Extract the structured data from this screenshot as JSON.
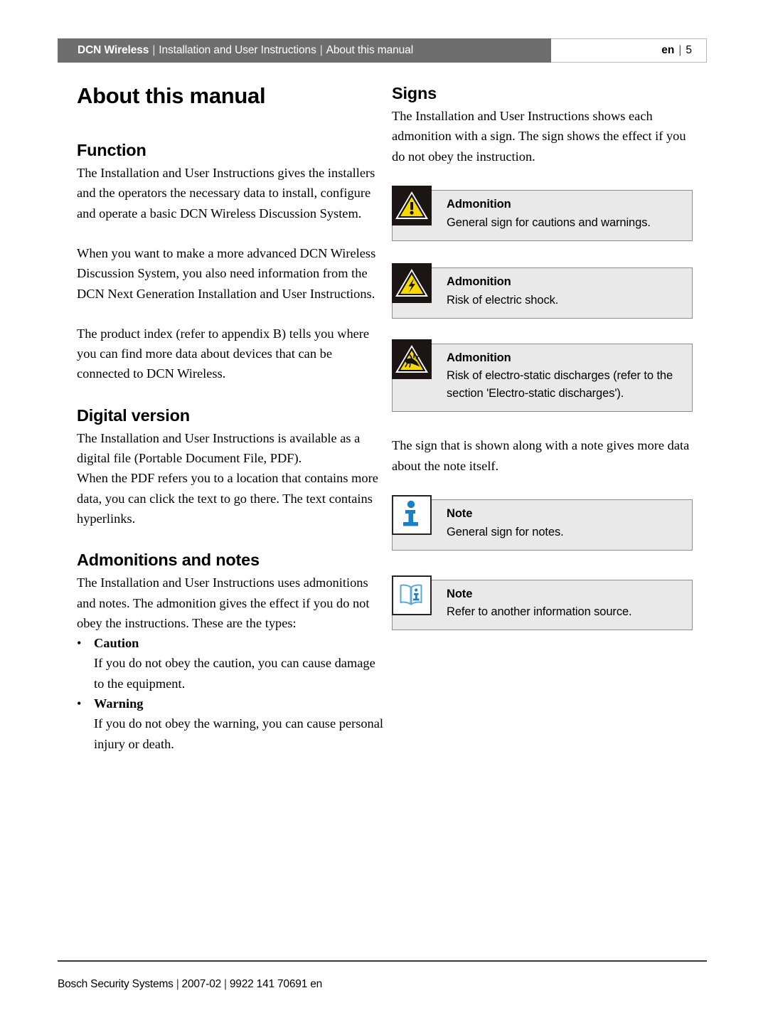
{
  "header": {
    "product": "DCN Wireless",
    "separator": "|",
    "doc_title": "Installation and User Instructions",
    "section": "About this manual",
    "language": "en",
    "page_number": "5"
  },
  "page_title": "About this manual",
  "left_column": {
    "function": {
      "heading": "Function",
      "paragraphs": [
        "The Installation and User Instructions gives the installers and the operators the necessary data to install, configure and operate a basic DCN Wireless Discussion System.",
        "When you want to make a more advanced DCN Wireless Discussion System, you also need information from the DCN Next Generation Installation and User Instructions.",
        "The product index (refer to appendix B) tells you where you can find more data about devices that can be connected to DCN Wireless."
      ]
    },
    "digital_version": {
      "heading": "Digital version",
      "paragraphs": [
        "The Installation and User Instructions is available as a digital file (Portable Document File, PDF).",
        "When the PDF refers you to a location that contains more data, you can click the text to go there. The text contains hyperlinks."
      ]
    },
    "admonitions_and_notes": {
      "heading": "Admonitions and notes",
      "intro": "The Installation and User Instructions uses admonitions and notes. The admonition gives the effect if you do not obey the instructions. These are the types:",
      "bullet": "•",
      "types": [
        {
          "term": "Caution",
          "description": "If you do not obey the caution, you can cause damage to the equipment."
        },
        {
          "term": "Warning",
          "description": "If you do not obey the warning, you can cause personal injury or death."
        }
      ]
    }
  },
  "right_column": {
    "signs": {
      "heading": "Signs",
      "intro": "The Installation and User Instructions shows each admonition with a sign. The sign shows the effect if you do not obey the instruction.",
      "note_intro": "The sign that is shown along with a note gives more data about the note itself."
    },
    "boxes": [
      {
        "icon": "warning-triangle-icon",
        "title": "Admonition",
        "text": "General sign for cautions and warnings."
      },
      {
        "icon": "electric-shock-icon",
        "title": "Admonition",
        "text": "Risk of electric shock."
      },
      {
        "icon": "esd-hand-icon",
        "title": "Admonition",
        "text": "Risk of electro-static discharges (refer to the section 'Electro-static discharges')."
      },
      {
        "icon": "info-i-icon",
        "title": "Note",
        "text": "General sign for notes."
      },
      {
        "icon": "open-book-info-icon",
        "title": "Note",
        "text": "Refer to another information source."
      }
    ]
  },
  "footer": {
    "company": "Bosch Security Systems",
    "separator": "|",
    "date": "2007-02",
    "doc_number": "9922 141 70691 en"
  },
  "colors": {
    "header_bar": "#6e6e6e",
    "box_background": "#e9e9e9",
    "box_border": "#8d8d8d",
    "warning_yellow": "#f5d900",
    "icon_black": "#1b1614",
    "note_blue": "#1b7fc4",
    "book_blue": "#5aa9d6"
  }
}
